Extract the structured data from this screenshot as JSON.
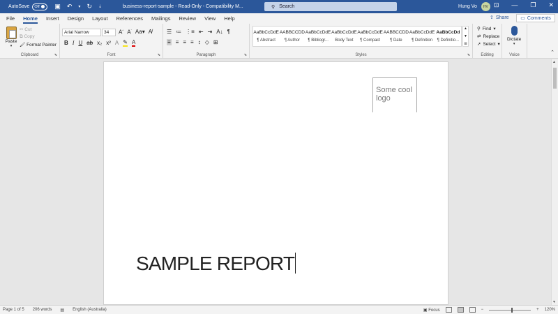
{
  "titlebar": {
    "autosave_label": "AutoSave",
    "autosave_state": "Off",
    "doc_title": "business-report-sample  -  Read-Only  -  Compatibility M...",
    "search_placeholder": "Search",
    "user_name": "Hung Vo",
    "user_initials": "HV"
  },
  "menu": {
    "tabs": [
      "File",
      "Home",
      "Insert",
      "Design",
      "Layout",
      "References",
      "Mailings",
      "Review",
      "View",
      "Help"
    ],
    "active_tab": "Home",
    "share_label": "Share",
    "comments_label": "Comments"
  },
  "ribbon": {
    "clipboard": {
      "label": "Clipboard",
      "paste": "Paste",
      "cut": "Cut",
      "copy": "Copy",
      "format_painter": "Format Painter"
    },
    "font": {
      "label": "Font",
      "name": "Arial Narrow",
      "size": "34"
    },
    "paragraph": {
      "label": "Paragraph"
    },
    "styles": {
      "label": "Styles",
      "items": [
        {
          "sample": "AaBbCcDdE",
          "name": "¶ Abstract"
        },
        {
          "sample": "AABBCCDD",
          "name": "¶ Author"
        },
        {
          "sample": "AaBbCcDdE",
          "name": "¶ Bibliogr..."
        },
        {
          "sample": "AaBbCcDdE",
          "name": "Body Text"
        },
        {
          "sample": "AaBbCcDdE",
          "name": "¶ Compact"
        },
        {
          "sample": "AABBCCDD",
          "name": "¶ Date"
        },
        {
          "sample": "AaBbCcDdE",
          "name": "¶ Definition"
        },
        {
          "sample": "AaBbCcDd",
          "name": "¶ Definitio..."
        }
      ]
    },
    "editing": {
      "label": "Editing",
      "find": "Find",
      "replace": "Replace",
      "select": "Select"
    },
    "voice": {
      "label": "Voice",
      "dictate": "Dictate"
    }
  },
  "document": {
    "logo_text_line1": "Some cool",
    "logo_text_line2": "logo",
    "title": "SAMPLE REPORT"
  },
  "status": {
    "page": "Page 1 of 5",
    "words": "206 words",
    "language": "English (Australia)",
    "focus": "Focus",
    "zoom": "120%"
  },
  "colors": {
    "accent": "#2b579a",
    "highlight": "#f7e318",
    "font_color": "#d00000"
  }
}
